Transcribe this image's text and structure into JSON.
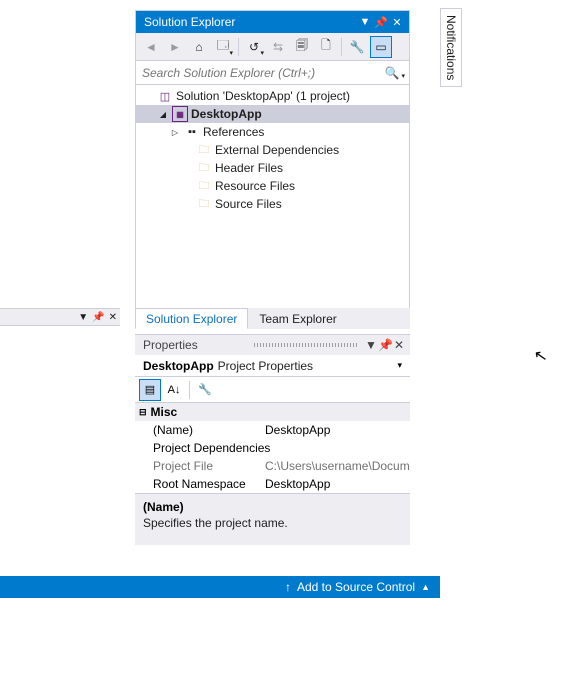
{
  "notifications_tab": "Notifications",
  "solution_explorer": {
    "title": "Solution Explorer",
    "search_placeholder": "Search Solution Explorer (Ctrl+;)",
    "tree": {
      "solution_label": "Solution 'DesktopApp' (1 project)",
      "project_label": "DesktopApp",
      "references": "References",
      "ext_deps": "External Dependencies",
      "header_files": "Header Files",
      "resource_files": "Resource Files",
      "source_files": "Source Files"
    }
  },
  "tabs": {
    "solution_explorer": "Solution Explorer",
    "team_explorer": "Team Explorer"
  },
  "properties": {
    "title": "Properties",
    "object_name": "DesktopApp",
    "object_type": "Project Properties",
    "category": "Misc",
    "rows": {
      "name_label": "(Name)",
      "name_value": "DesktopApp",
      "deps_label": "Project Dependencies",
      "deps_value": "",
      "file_label": "Project File",
      "file_value": "C:\\Users\\username\\Docum",
      "ns_label": "Root Namespace",
      "ns_value": "DesktopApp"
    },
    "desc_name": "(Name)",
    "desc_text": "Specifies the project name."
  },
  "status_bar": {
    "add_source_control": "Add to Source Control"
  }
}
